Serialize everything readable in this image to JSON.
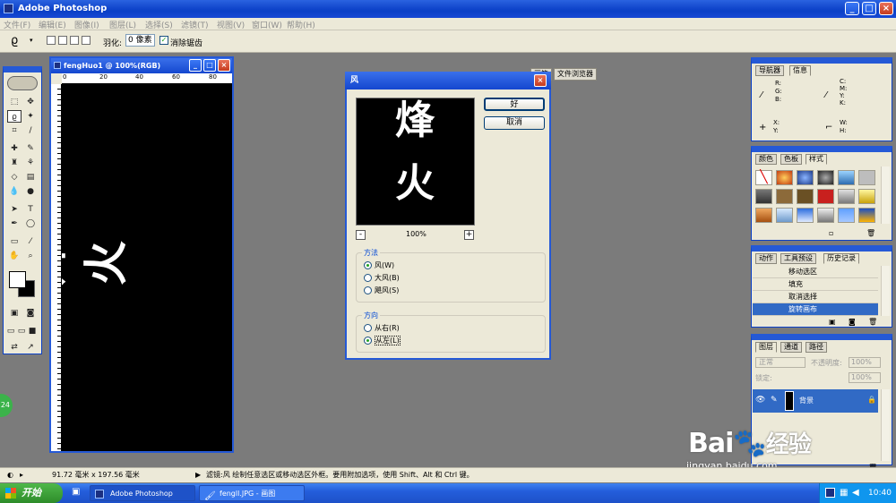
{
  "app": {
    "title": "Adobe Photoshop"
  },
  "menu": [
    "文件(F)",
    "编辑(E)",
    "图像(I)",
    "图层(L)",
    "选择(S)",
    "滤镜(T)",
    "视图(V)",
    "窗口(W)",
    "帮助(H)"
  ],
  "options": {
    "feather_label": "羽化:",
    "feather_value": "0 像素",
    "antialias_label": "消除锯齿"
  },
  "palette_well": [
    "画笔",
    "文件浏览器"
  ],
  "document": {
    "title": "fengHuo1 @ 100%(RGB)",
    "ruler_ticks": [
      "0",
      "20",
      "40",
      "60",
      "80"
    ],
    "art_text": [
      "烽",
      "火"
    ]
  },
  "dialog": {
    "title": "风",
    "ok_label": "好",
    "cancel_label": "取消",
    "zoom": "100%",
    "method": {
      "label": "方法",
      "options": [
        "风(W)",
        "大风(B)",
        "飓风(S)"
      ],
      "selected": 0
    },
    "direction": {
      "label": "方向",
      "options": [
        "从右(R)",
        "从左(L)"
      ],
      "selected": 1
    },
    "preview_text": [
      "烽",
      "火"
    ]
  },
  "navigator": {
    "tabs": [
      "导航器",
      "信息"
    ],
    "rgb": "R:\nG:\nB:",
    "cmyk": "C:\nM:\nY:\nK:",
    "xy": "X:\nY:",
    "wh": "W:\nH:"
  },
  "color_palette": {
    "tabs": [
      "颜色",
      "色板",
      "样式"
    ]
  },
  "history": {
    "tabs": [
      "动作",
      "工具预设",
      "历史记录"
    ],
    "items": [
      "移动选区",
      "填充",
      "取消选择",
      "旋转画布"
    ],
    "selected": 3
  },
  "layers": {
    "tabs": [
      "图层",
      "通道",
      "路径"
    ],
    "blend_mode": "正常",
    "opacity_label": "不透明度:",
    "opacity_value": "100%",
    "lock_label": "锁定:",
    "fill_value": "100%",
    "layer_name": "背景"
  },
  "status": {
    "doc_size": "91.72 毫米 x 197.56 毫米",
    "hint": "滤镜:风  绘制任意选区或移动选区外框。要用附加选项，使用 Shift、Alt 和 Ctrl 键。"
  },
  "taskbar": {
    "start": "开始",
    "tasks": [
      "Adobe Photoshop",
      "fengll.JPG - 画图"
    ],
    "time": "10:40"
  },
  "watermark": {
    "brand": "Bai",
    "brand2": "经验",
    "url": "jingyan.baidu.com"
  },
  "badge": "24"
}
